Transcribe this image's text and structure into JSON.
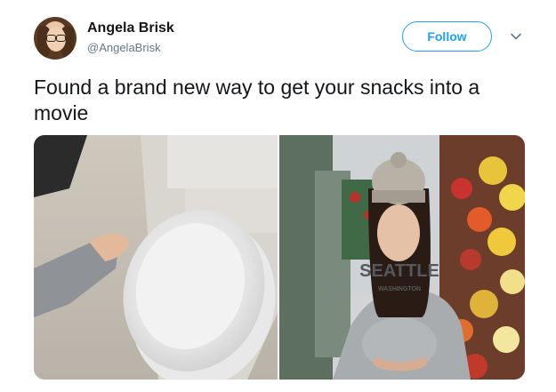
{
  "user": {
    "name": "Angela Brisk",
    "handle": "@AngelaBrisk"
  },
  "follow": {
    "label": "Follow"
  },
  "tweet": {
    "text": "Found a brand new way to get your snacks into a movie"
  },
  "media": {
    "photo2_shirt_text": "SEATTLE",
    "photo2_shirt_subtext": "WASHINGTON"
  },
  "colors": {
    "accent": "#1da1f2",
    "text": "#14171a",
    "secondary": "#657786"
  },
  "icons": [
    "chevron-down-icon"
  ]
}
